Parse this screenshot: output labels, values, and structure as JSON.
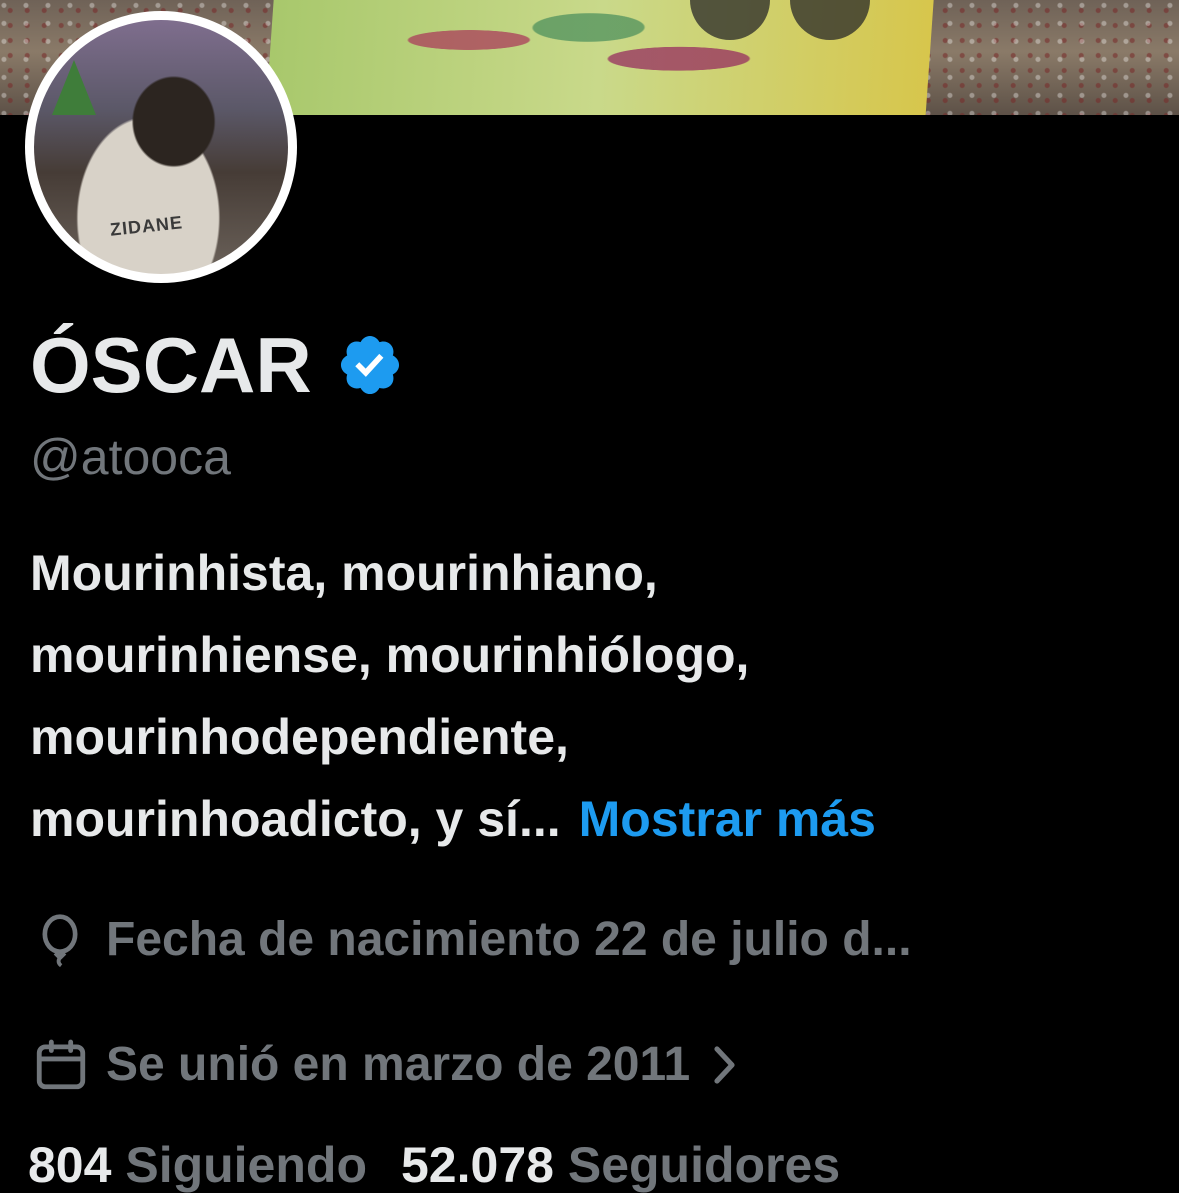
{
  "profile": {
    "display_name": "ÓSCAR",
    "handle": "@atooca",
    "avatar_jersey_text": "ZIDANE",
    "bio_lines": [
      "Mourinhista, mourinhiano,",
      "mourinhiense, mourinhiólogo,",
      "mourinhodependiente,",
      "mourinhoadicto, y sí..."
    ],
    "show_more_label": "Mostrar más",
    "birth_date_text": "Fecha de nacimiento 22 de julio d...",
    "joined_text": "Se unió en marzo de 2011",
    "following_count": "804",
    "following_label": "Siguiendo",
    "followers_count": "52.078",
    "followers_label": "Seguidores"
  },
  "colors": {
    "background": "#000000",
    "primary_text": "#e7e9ea",
    "secondary_text": "#71767b",
    "accent_link": "#1d9bf0",
    "verified_badge": "#1d9bf0"
  },
  "icons": [
    "verified-badge-icon",
    "balloon-icon",
    "calendar-icon",
    "chevron-right-icon"
  ]
}
